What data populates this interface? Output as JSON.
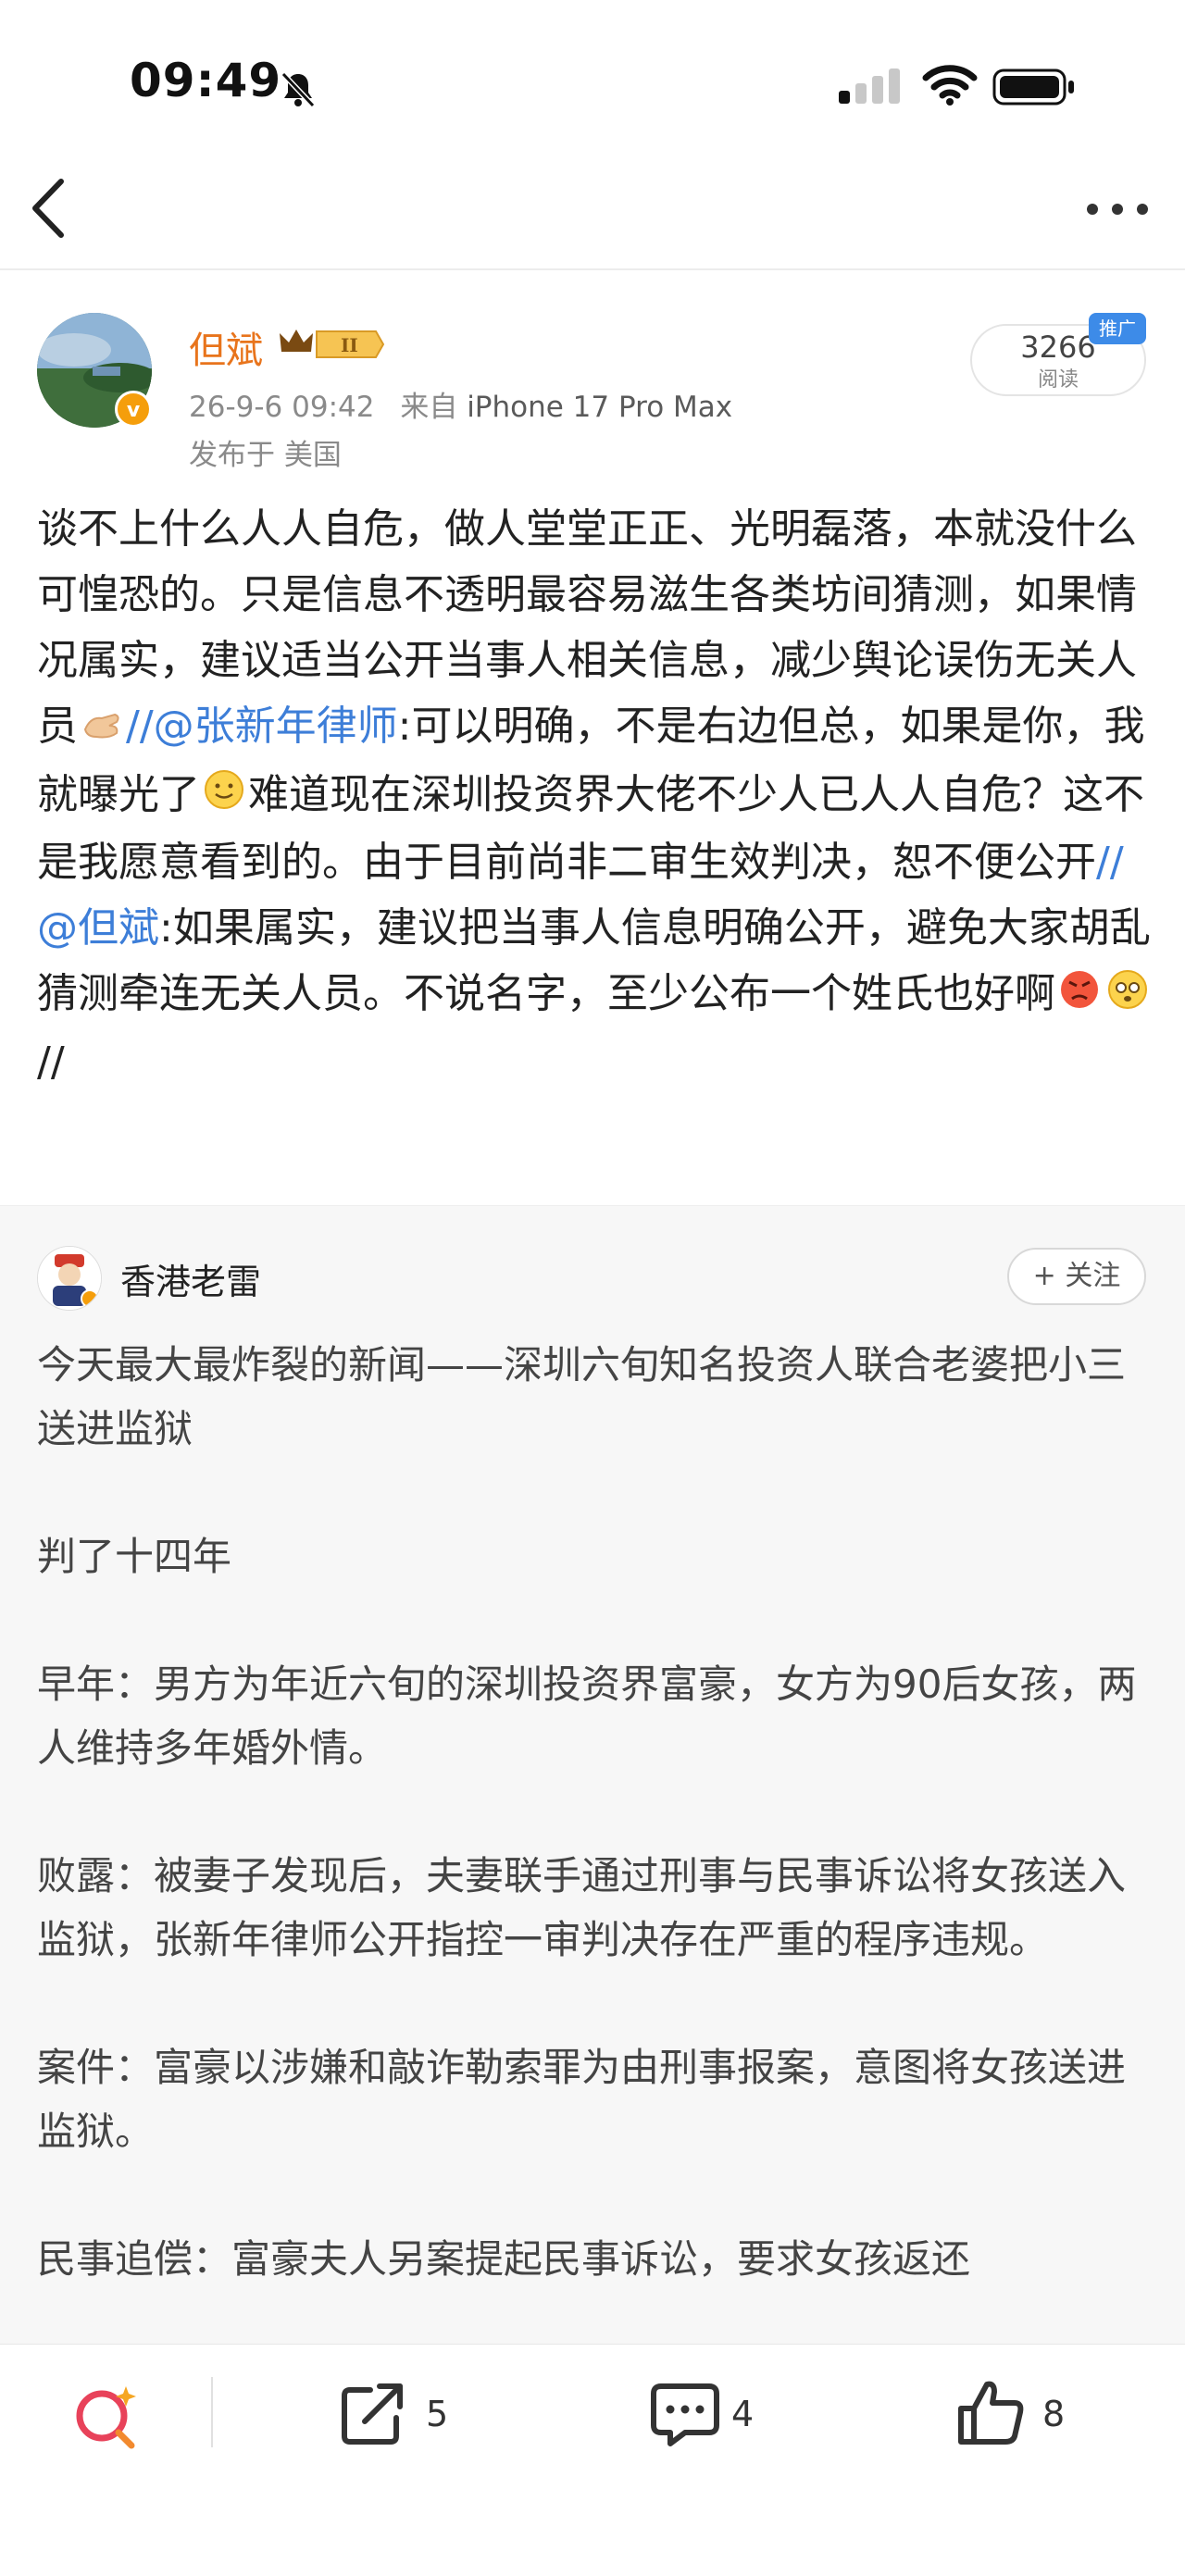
{
  "status_bar": {
    "time": "09:49"
  },
  "post": {
    "author": "但斌",
    "level_badge": "II",
    "avatar_badge": "v",
    "date": "26-9-6 09:42",
    "source_prefix": "来自",
    "device": "iPhone 17 Pro Max",
    "location": "发布于 美国",
    "reads_count": "3266",
    "reads_label": "阅读",
    "promo_tag": "推广",
    "text_1": "谈不上什么人人自危，做人堂堂正正、光明磊落，本就没什么可惶恐的。只是信息不透明最容易滋生各类坊间猜测，如果情况属实，建议适当公开当事人相关信息，减少舆论误伤无关人员",
    "mention_1": "//@张新年律师",
    "text_2": ":可以明确，不是右边但总，如果是你，我就曝光了",
    "text_3": "难道现在深圳投资界大佬不少人已人人自危？这不是我愿意看到的。由于目前尚非二审生效判决，恕不便公开",
    "mention_2": "//@但斌",
    "text_4": ":如果属实，建议把当事人信息明确公开，避免大家胡乱猜测牵连无关人员。不说名字，至少公布一个姓氏也好啊",
    "text_end": "//"
  },
  "repost": {
    "author": "香港老雷",
    "follow_label": "+ 关注",
    "paragraphs": [
      "今天最大最炸裂的新闻——深圳六旬知名投资人联合老婆把小三送进监狱",
      "判了十四年",
      "早年：男方为年近六旬的深圳投资界富豪，女方为90后女孩，两人维持多年婚外情。",
      "败露：被妻子发现后，夫妻联手通过刑事与民事诉讼将女孩送入监狱，张新年律师公开指控一审判决存在严重的程序违规。",
      "案件：富豪以涉嫌和敲诈勒索罪为由刑事报案，意图将女孩送进监狱。",
      "民事追偿：富豪夫人另案提起民事诉讼，要求女孩返还"
    ]
  },
  "toolbar": {
    "repost_count": "5",
    "comment_count": "4",
    "like_count": "8"
  },
  "colors": {
    "author_orange": "#e8741c",
    "mention_blue": "#3d7ed8",
    "promo_blue": "#3d8be8",
    "search_red": "#e8425a"
  },
  "icons": [
    "bell-slash-icon",
    "signal-icon",
    "wifi-icon",
    "battery-icon",
    "back-icon",
    "more-icon",
    "crown-icon",
    "hands-emoji",
    "smile-emoji",
    "angry-emoji",
    "pleading-emoji",
    "search-icon",
    "repost-icon",
    "comment-icon",
    "like-icon"
  ]
}
